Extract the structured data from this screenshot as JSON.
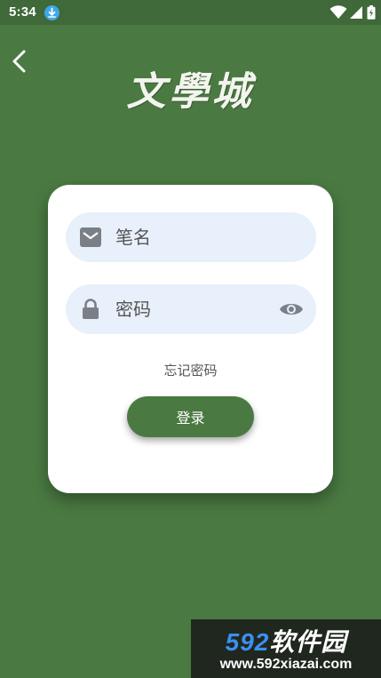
{
  "status_bar": {
    "time": "5:34"
  },
  "header": {
    "logo_text": "文學城"
  },
  "login_form": {
    "username_placeholder": "笔名",
    "password_placeholder": "密码",
    "forgot_password": "忘记密码",
    "login_label": "登录"
  },
  "watermark": {
    "brand_number": "592",
    "brand_text": "软件园",
    "url": "www.592xiazai.com"
  },
  "colors": {
    "background": "#4a7a42",
    "card": "#ffffff",
    "field": "#e8f0fb",
    "button": "#4a7a42"
  }
}
